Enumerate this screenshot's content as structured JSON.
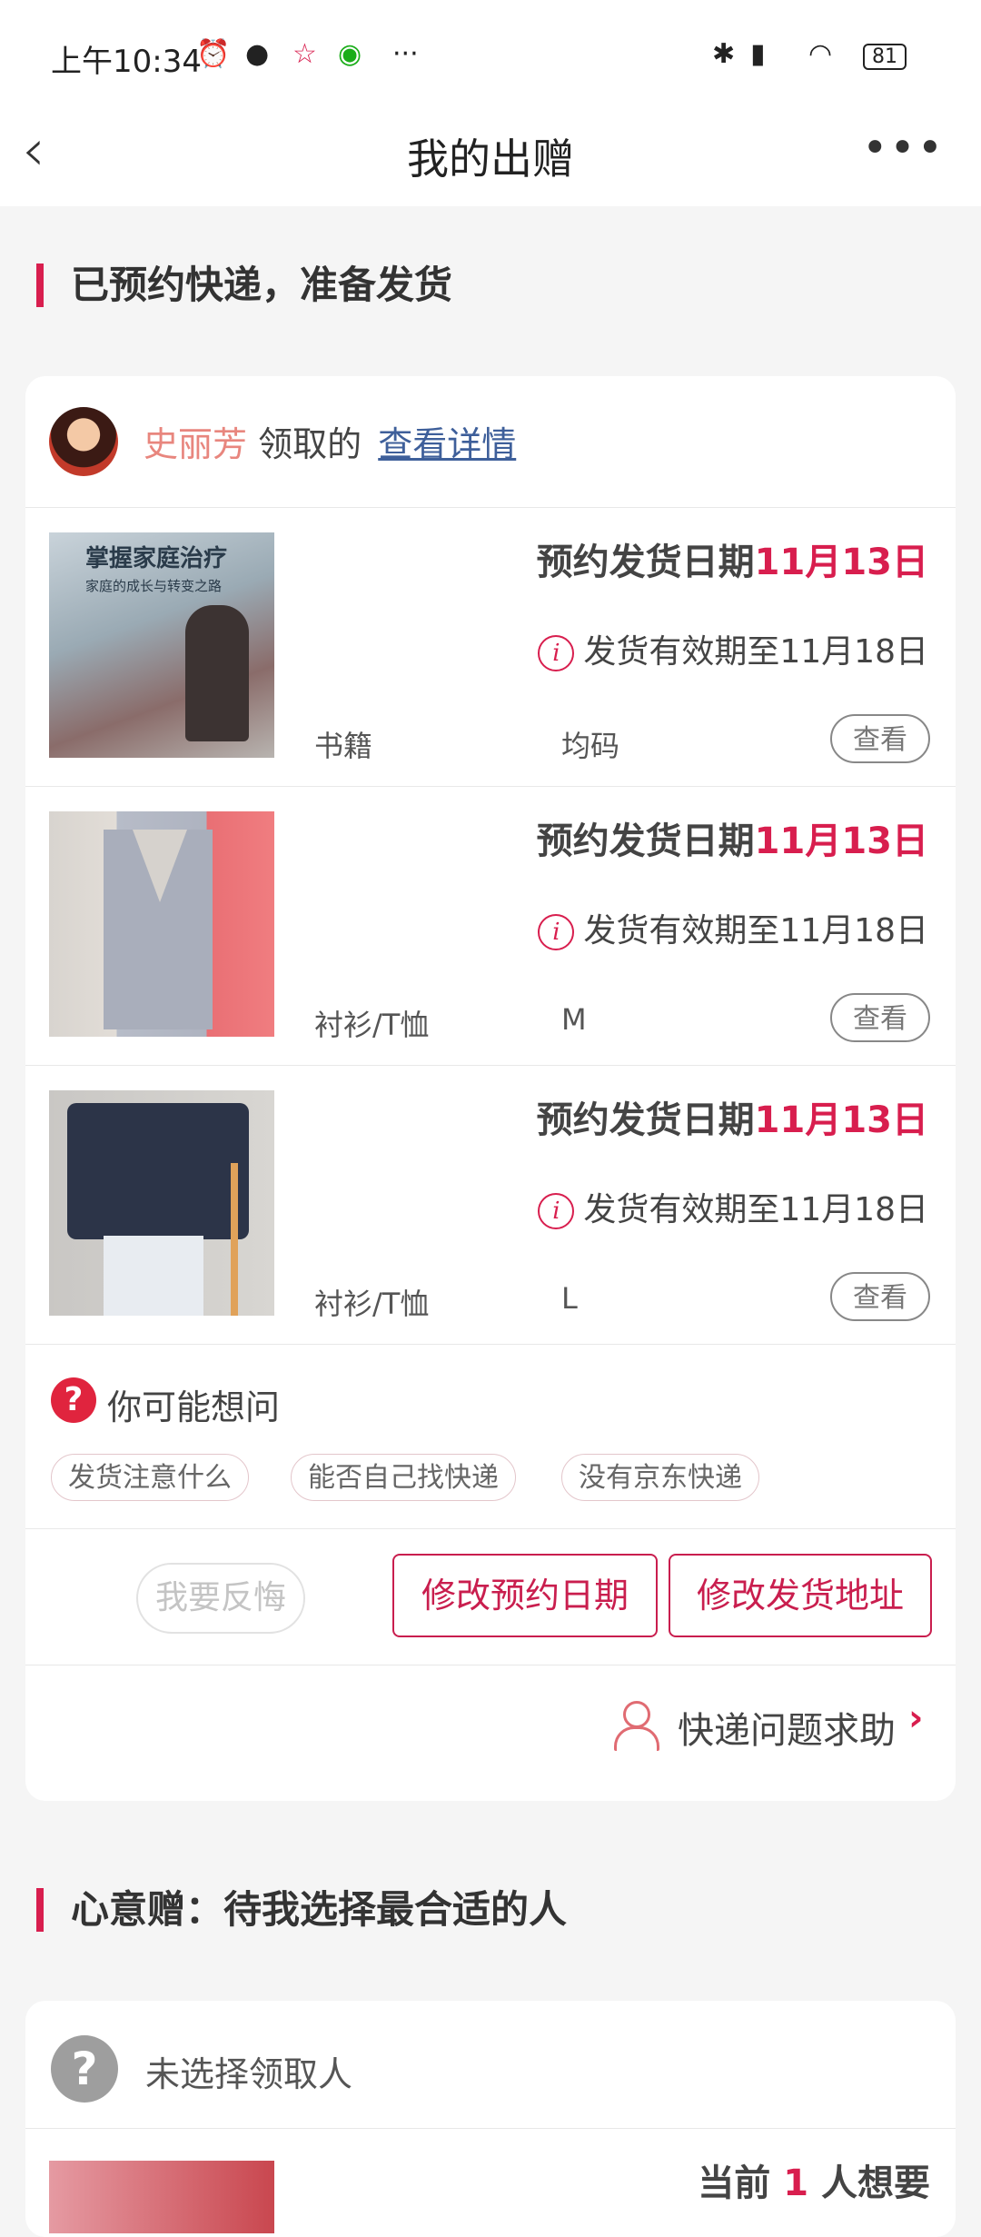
{
  "status_bar": {
    "time": "上午10:34",
    "battery": "81"
  },
  "nav": {
    "title": "我的出赠"
  },
  "section1": {
    "title": "已预约快递，准备发货"
  },
  "claim": {
    "name": "史丽芳",
    "action": "领取的",
    "link": "查看详情"
  },
  "items": [
    {
      "date_label": "预约发货日期",
      "date": "11月13日",
      "validity": "发货有效期至11月18日",
      "category": "书籍",
      "size": "均码",
      "view": "查看"
    },
    {
      "date_label": "预约发货日期",
      "date": "11月13日",
      "validity": "发货有效期至11月18日",
      "category": "衬衫/T恤",
      "size": "M",
      "view": "查看"
    },
    {
      "date_label": "预约发货日期",
      "date": "11月13日",
      "validity": "发货有效期至11月18日",
      "category": "衬衫/T恤",
      "size": "L",
      "view": "查看"
    }
  ],
  "book_cover": {
    "title": "掌握家庭治疗",
    "subtitle": "家庭的成长与转变之路"
  },
  "faq": {
    "title": "你可能想问",
    "chips": [
      "发货注意什么",
      "能否自己找快递",
      "没有京东快递"
    ]
  },
  "actions": {
    "regret": "我要反悔",
    "change_date": "修改预约日期",
    "change_address": "修改发货地址"
  },
  "help": {
    "label": "快递问题求助"
  },
  "section2": {
    "title": "心意赠：待我选择最合适的人"
  },
  "card2": {
    "no_receiver": "未选择领取人",
    "want_prefix": "当前",
    "want_count": "1",
    "want_suffix": "人想要"
  },
  "colors": {
    "accent": "#d81e4e",
    "link": "#3e5f9a"
  }
}
